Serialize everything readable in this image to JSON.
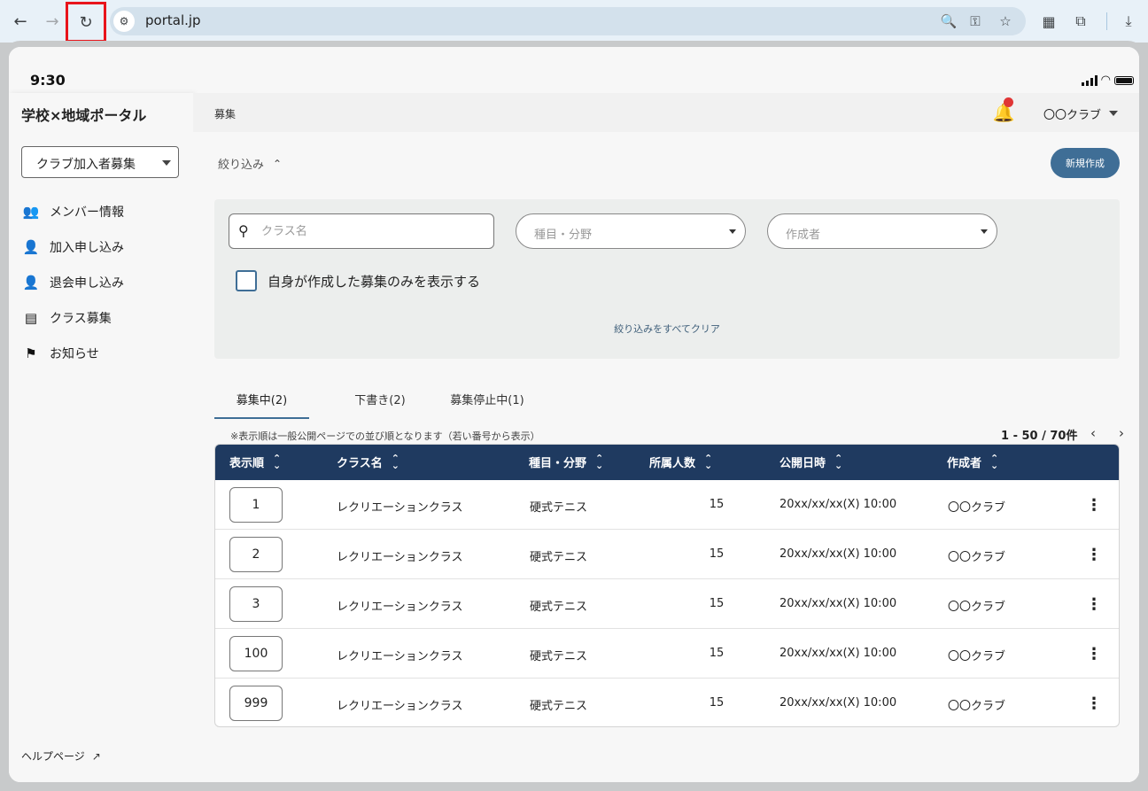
{
  "browser": {
    "url": "portal.jp",
    "back_icon": "←",
    "forward_icon": "→",
    "reload_icon": "↻"
  },
  "status": {
    "time": "9:30"
  },
  "sidebar": {
    "brand": "学校×地域ポータル",
    "club_select": "クラブ加入者募集",
    "items": [
      {
        "label": "メンバー情報",
        "icon": "group-icon"
      },
      {
        "label": "加入申し込み",
        "icon": "person-add-icon"
      },
      {
        "label": "退会申し込み",
        "icon": "person-remove-icon"
      },
      {
        "label": "クラス募集",
        "icon": "calendar-icon"
      },
      {
        "label": "お知らせ",
        "icon": "campaign-icon"
      }
    ],
    "help": "ヘルプページ"
  },
  "header": {
    "breadcrumb": "募集",
    "account": "〇〇クラブ"
  },
  "filter": {
    "toggle_label": "絞り込み",
    "new_button": "新規作成",
    "search_placeholder": "クラス名",
    "category_placeholder": "種目・分野",
    "author_placeholder": "作成者",
    "only_mine_label": "自身が作成した募集のみを表示する",
    "clear_all": "絞り込みをすべてクリア"
  },
  "tabs": [
    {
      "label": "募集中(2)",
      "active": true
    },
    {
      "label": "下書き(2)",
      "active": false
    },
    {
      "label": "募集停止中(1)",
      "active": false
    }
  ],
  "list": {
    "note": "※表示順は一般公開ページでの並び順となります（若い番号から表示）",
    "pager": "1 - 50 / 70件",
    "columns": [
      "表示順",
      "クラス名",
      "種目・分野",
      "所属人数",
      "公開日時",
      "作成者"
    ],
    "rows": [
      {
        "order": "1",
        "name": "レクリエーションクラス",
        "category": "硬式テニス",
        "members": "15",
        "published": "20xx/xx/xx(X) 10:00",
        "author": "〇〇クラブ"
      },
      {
        "order": "2",
        "name": "レクリエーションクラス",
        "category": "硬式テニス",
        "members": "15",
        "published": "20xx/xx/xx(X) 10:00",
        "author": "〇〇クラブ"
      },
      {
        "order": "3",
        "name": "レクリエーションクラス",
        "category": "硬式テニス",
        "members": "15",
        "published": "20xx/xx/xx(X) 10:00",
        "author": "〇〇クラブ"
      },
      {
        "order": "100",
        "name": "レクリエーションクラス",
        "category": "硬式テニス",
        "members": "15",
        "published": "20xx/xx/xx(X) 10:00",
        "author": "〇〇クラブ"
      },
      {
        "order": "999",
        "name": "レクリエーションクラス",
        "category": "硬式テニス",
        "members": "15",
        "published": "20xx/xx/xx(X) 10:00",
        "author": "〇〇クラブ"
      }
    ]
  },
  "colors": {
    "accent": "#3f6e96",
    "table_header": "#1f3a60",
    "notification_dot": "#e03535",
    "highlight_border": "#e8141b"
  }
}
